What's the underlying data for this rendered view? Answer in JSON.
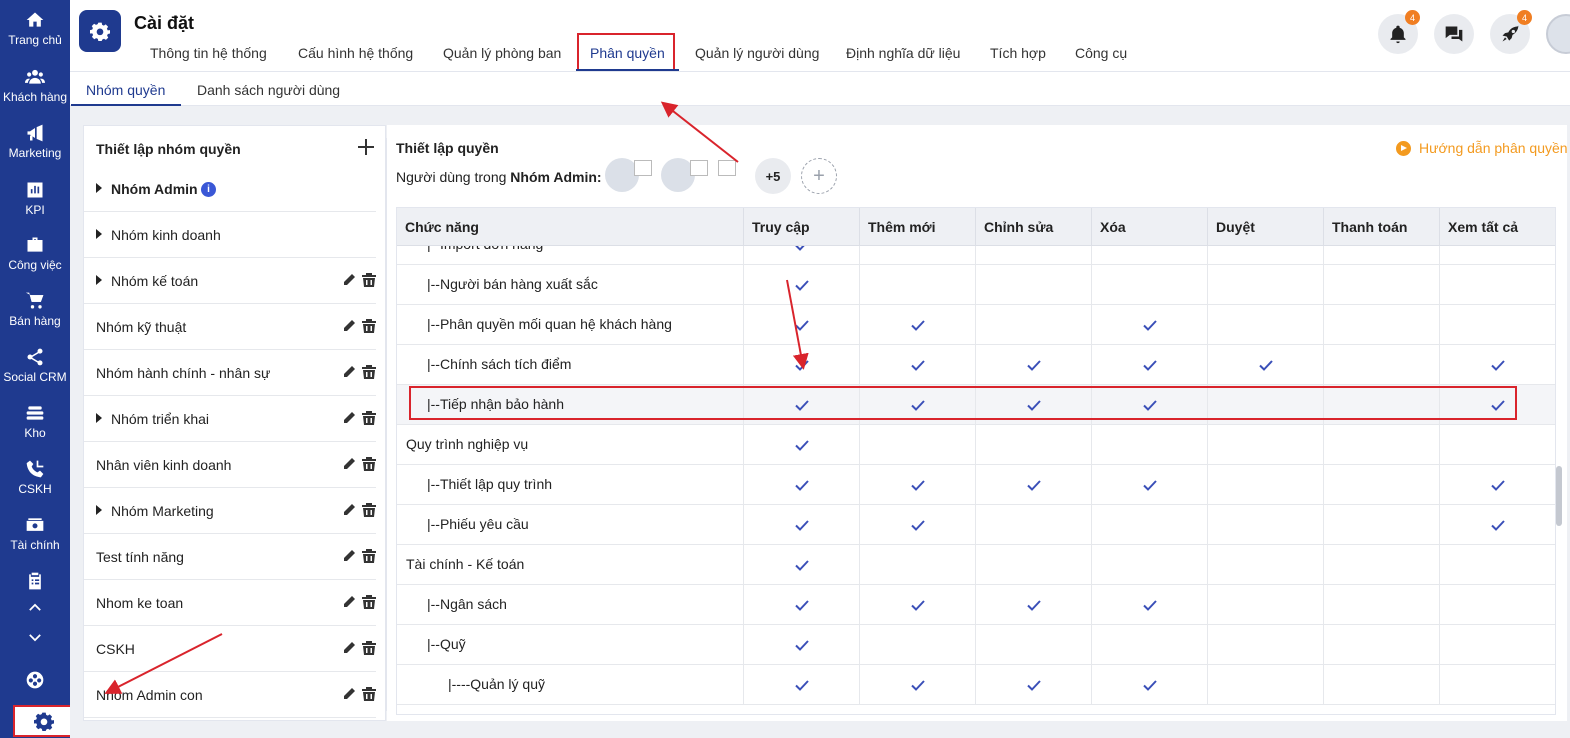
{
  "sidebar": {
    "items": [
      {
        "label": "Trang chủ",
        "icon": "home-icon"
      },
      {
        "label": "Khách hàng",
        "icon": "users-icon"
      },
      {
        "label": "Marketing",
        "icon": "megaphone-icon"
      },
      {
        "label": "KPI",
        "icon": "chart-icon"
      },
      {
        "label": "Công việc",
        "icon": "briefcase-icon"
      },
      {
        "label": "Bán hàng",
        "icon": "cart-icon"
      },
      {
        "label": "Social CRM",
        "icon": "share-icon"
      },
      {
        "label": "Kho",
        "icon": "warehouse-icon"
      },
      {
        "label": "CSKH",
        "icon": "phone-icon"
      },
      {
        "label": "Tài chính",
        "icon": "money-icon"
      }
    ]
  },
  "header": {
    "title": "Cài đặt",
    "tabs": [
      {
        "label": "Thông tin hệ thống"
      },
      {
        "label": "Cấu hình hệ thống"
      },
      {
        "label": "Quản lý phòng ban"
      },
      {
        "label": "Phân quyền"
      },
      {
        "label": "Quản lý người dùng"
      },
      {
        "label": "Định nghĩa dữ liệu"
      },
      {
        "label": "Tích hợp"
      },
      {
        "label": "Công cụ"
      }
    ],
    "notification_count": "4",
    "rocket_count": "4"
  },
  "subtabs": [
    {
      "label": "Nhóm quyền"
    },
    {
      "label": "Danh sách người dùng"
    }
  ],
  "groups_panel": {
    "title": "Thiết lập nhóm quyền",
    "groups": [
      {
        "name": "Nhóm Admin"
      },
      {
        "name": "Nhóm kinh doanh"
      },
      {
        "name": "Nhóm kế toán"
      },
      {
        "name": "Nhóm kỹ thuật"
      },
      {
        "name": "Nhóm hành chính - nhân sự"
      },
      {
        "name": "Nhóm triển khai"
      },
      {
        "name": "Nhân viên kinh doanh"
      },
      {
        "name": "Nhóm Marketing"
      },
      {
        "name": "Test tính năng"
      },
      {
        "name": "Nhom ke toan"
      },
      {
        "name": "CSKH"
      },
      {
        "name": "Nhóm Admin con"
      }
    ]
  },
  "permissions_panel": {
    "title": "Thiết lập quyền",
    "guide_link": "Hướng dẫn phân quyền",
    "users_label_prefix": "Người dùng trong",
    "users_group": "Nhóm Admin:",
    "more_users": "+5",
    "add_user": "+",
    "columns": [
      "Chức năng",
      "Truy cập",
      "Thêm mới",
      "Chỉnh sửa",
      "Xóa",
      "Duyệt",
      "Thanh toán",
      "Xem tất cả"
    ],
    "rows": [
      {
        "label": "|--Import đơn hàng",
        "checks": [
          true,
          false,
          false,
          false,
          false,
          false,
          false
        ]
      },
      {
        "label": "|--Người bán hàng xuất sắc",
        "checks": [
          true,
          false,
          false,
          false,
          false,
          false,
          false
        ]
      },
      {
        "label": "|--Phân quyền mối quan hệ khách hàng",
        "checks": [
          true,
          true,
          false,
          true,
          false,
          false,
          false
        ]
      },
      {
        "label": "|--Chính sách tích điểm",
        "checks": [
          true,
          true,
          true,
          true,
          true,
          false,
          true
        ]
      },
      {
        "label": "|--Tiếp nhận bảo hành",
        "checks": [
          true,
          true,
          true,
          true,
          false,
          false,
          true
        ]
      },
      {
        "label": "Quy trình nghiệp vụ",
        "checks": [
          true,
          false,
          false,
          false,
          false,
          false,
          false
        ]
      },
      {
        "label": "|--Thiết lập quy trình",
        "checks": [
          true,
          true,
          true,
          true,
          false,
          false,
          true
        ]
      },
      {
        "label": "|--Phiếu yêu cầu",
        "checks": [
          true,
          true,
          false,
          false,
          false,
          false,
          true
        ]
      },
      {
        "label": "Tài chính - Kế toán",
        "checks": [
          true,
          false,
          false,
          false,
          false,
          false,
          false
        ]
      },
      {
        "label": "|--Ngân sách",
        "checks": [
          true,
          true,
          true,
          true,
          false,
          false,
          false
        ]
      },
      {
        "label": "|--Quỹ",
        "checks": [
          true,
          false,
          false,
          false,
          false,
          false,
          false
        ]
      },
      {
        "label": "|----Quản lý quỹ",
        "checks": [
          true,
          true,
          true,
          true,
          false,
          false,
          false
        ]
      }
    ]
  },
  "colors": {
    "sidebar_bg": "#1f3a8f",
    "check": "#3a4fb8",
    "annotation_red": "#d9242c",
    "guide_orange": "#f39a1f"
  }
}
